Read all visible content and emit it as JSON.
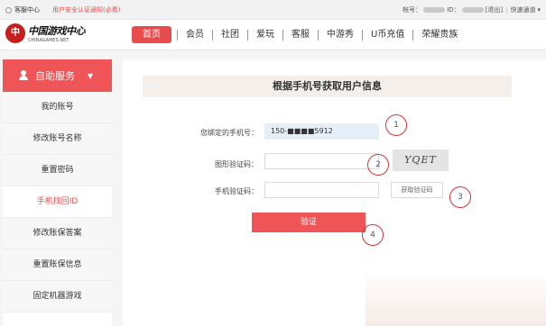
{
  "topbar": {
    "customer_service": "客服中心",
    "notice": "用户安全认证通知(必看)",
    "account_label": "帐号：",
    "id_label": "ID：",
    "logout": "[退出]",
    "quick_login": "快速通道"
  },
  "logo": {
    "cn": "中国游戏中心",
    "en": "CHINAGAMES.NET",
    "mark": "中"
  },
  "nav": {
    "items": [
      "首页",
      "会员",
      "社团",
      "爱玩",
      "客服",
      "中游秀",
      "U币充值",
      "荣耀贵族"
    ]
  },
  "sidebar": {
    "header": "自助服务",
    "items": [
      "我的账号",
      "修改账号名称",
      "重置密码",
      "手机找回ID",
      "修改账保答案",
      "重置账保信息",
      "固定机器游戏"
    ]
  },
  "panel": {
    "title": "根据手机号获取用户信息",
    "phone_label": "您绑定的手机号：",
    "phone_value": "150-■■■■5912",
    "captcha_label": "图形验证码：",
    "captcha_text": "YQET",
    "sms_label": "手机验证码：",
    "sms_button": "获取验证码",
    "verify_button": "验证"
  },
  "markers": [
    "1",
    "2",
    "3",
    "4"
  ],
  "colors": {
    "accent": "#ef5456",
    "nav_active": "#e84c4c"
  }
}
